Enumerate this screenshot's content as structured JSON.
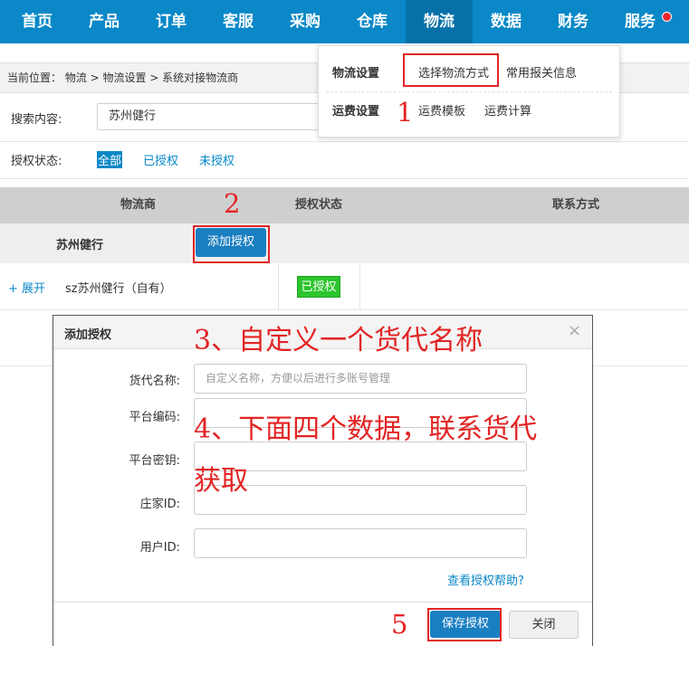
{
  "nav": {
    "items": [
      "首页",
      "产品",
      "订单",
      "客服",
      "采购",
      "仓库",
      "物流",
      "数据",
      "财务",
      "服务"
    ],
    "active_index": 6
  },
  "breadcrumb": {
    "text": "当前位置： 物流 > 物流设置 > 系统对接物流商"
  },
  "search": {
    "label": "搜索内容:",
    "value": "苏州健行"
  },
  "status_filter": {
    "label": "授权状态:",
    "options": [
      "全部",
      "已授权",
      "未授权"
    ],
    "selected_index": 0
  },
  "table": {
    "headers": [
      "物流商",
      "授权状态",
      "联系方式"
    ],
    "group": {
      "name": "苏州健行",
      "add_button": "添加授权"
    },
    "rows": [
      {
        "expand": "+ 展开",
        "name": "sz苏州健行（自有）",
        "status": "已授权"
      }
    ]
  },
  "dropdown": {
    "sections": [
      {
        "title": "物流设置",
        "links": [
          "选择物流方式",
          "常用报关信息"
        ]
      },
      {
        "title": "运费设置",
        "links": [
          "运费模板",
          "运费计算"
        ]
      }
    ]
  },
  "modal": {
    "title": "添加授权",
    "close": "×",
    "fields": [
      {
        "label": "货代名称:",
        "placeholder": "自定义名称，方便以后进行多账号管理"
      },
      {
        "label": "平台编码:",
        "placeholder": ""
      },
      {
        "label": "平台密钥:",
        "placeholder": ""
      },
      {
        "label": "庄家ID:",
        "placeholder": ""
      },
      {
        "label": "用户ID:",
        "placeholder": ""
      }
    ],
    "help_link": "查看授权帮助?",
    "save_button": "保存授权",
    "close_button": "关闭"
  },
  "annotations": {
    "step1": "1",
    "step2": "2",
    "step3": "3、自定义一个货代名称",
    "step4_line1": "4、下面四个数据，联系货代",
    "step4_line2": "获取",
    "step5": "5"
  },
  "colors": {
    "nav_bg": "#0a88c8",
    "nav_active": "#0671a9",
    "primary_button": "#1a7fc1",
    "authorized_badge": "#2cc52c",
    "annotation_red": "#e32424"
  }
}
